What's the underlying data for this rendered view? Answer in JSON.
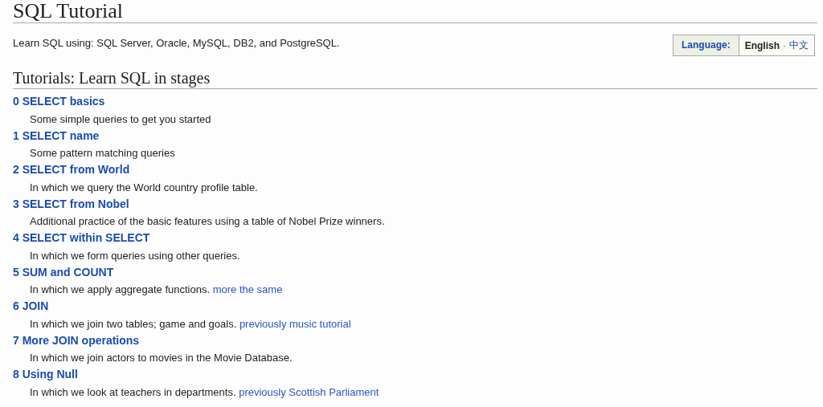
{
  "page": {
    "title": "SQL Tutorial",
    "intro": "Learn SQL using: SQL Server, Oracle, MySQL, DB2, and PostgreSQL."
  },
  "language": {
    "label": "Language:",
    "options": [
      {
        "label": "English",
        "selected": true
      },
      {
        "label": "中文",
        "selected": false
      }
    ],
    "separator": "·"
  },
  "section": {
    "heading": "Tutorials: Learn SQL in stages"
  },
  "tutorials": [
    {
      "title": "0 SELECT basics",
      "description": "Some simple queries to get you started"
    },
    {
      "title": "1 SELECT name",
      "description": "Some pattern matching queries"
    },
    {
      "title": "2 SELECT from World",
      "description": "In which we query the World country profile table."
    },
    {
      "title": "3 SELECT from Nobel",
      "description": "Additional practice of the basic features using a table of Nobel Prize winners."
    },
    {
      "title": "4 SELECT within SELECT",
      "description": "In which we form queries using other queries."
    },
    {
      "title": "5 SUM and COUNT",
      "description": "In which we apply aggregate functions.",
      "link": "more the same"
    },
    {
      "title": "6 JOIN",
      "description": "In which we join two tables; game and goals.",
      "link": "previously music tutorial"
    },
    {
      "title": "7 More JOIN operations",
      "description": "In which we join actors to movies in the Movie Database."
    },
    {
      "title": "8 Using Null",
      "description": "In which we look at teachers in departments.",
      "link": "previously Scottish Parliament"
    }
  ]
}
